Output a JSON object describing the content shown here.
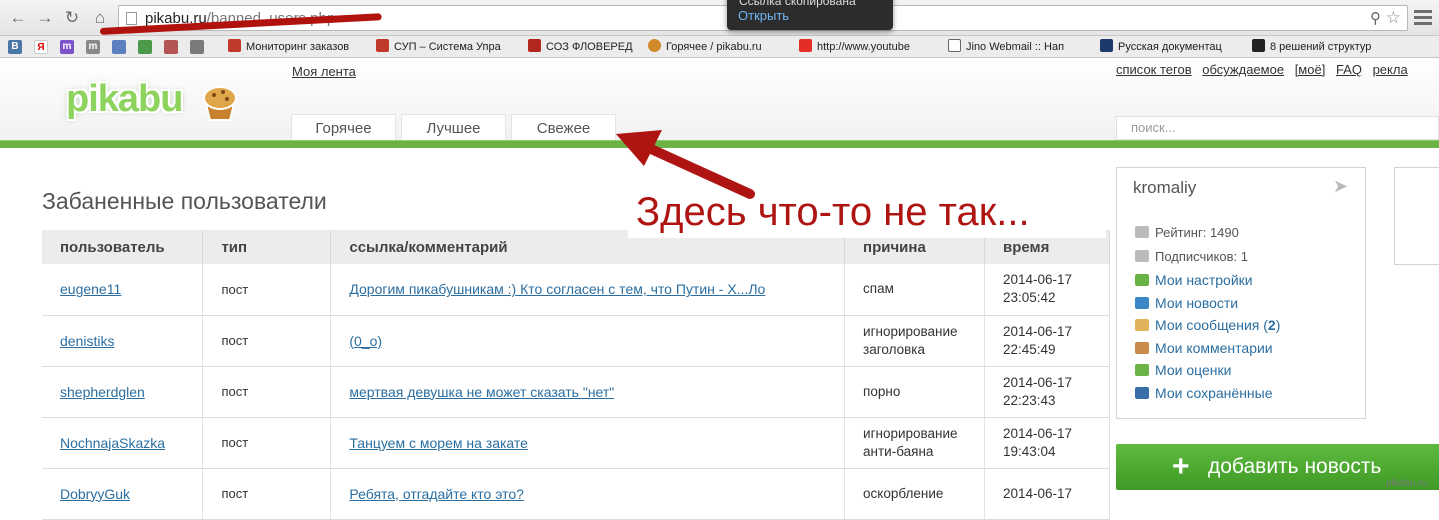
{
  "browser": {
    "url_host": "pikabu.ru",
    "url_path": "/banned_users.php",
    "popup": {
      "copied_text": "Ссылка скопирована",
      "open_label": "Открыть"
    },
    "bookmarks": [
      "Мониторинг заказов",
      "СУП – Система Упра",
      "СОЗ ФЛОВЕРЕД",
      "Горячее / pikabu.ru",
      "http://www.youtube",
      "Jino Webmail :: Нап",
      "Русская документац",
      "8 решений структур"
    ],
    "colors": {
      "annotation_red": "#ae1412",
      "site_green": "#6ab344",
      "link_blue": "#2a6ea1"
    }
  },
  "header": {
    "logo": "pikabu",
    "my_feed": "Моя лента",
    "top_links": [
      "список тегов",
      "обсуждаемое",
      "[моё]",
      "FAQ",
      "рекла"
    ],
    "tabs": [
      "Горячее",
      "Лучшее",
      "Свежее"
    ],
    "search_placeholder": "поиск..."
  },
  "main": {
    "title": "Забаненные пользователи",
    "annotation": "Здесь что-то не так...",
    "columns": [
      "пользователь",
      "тип",
      "ссылка/комментарий",
      "причина",
      "время"
    ],
    "rows": [
      {
        "user": "eugene11",
        "type": "пост",
        "link": "Дорогим пикабушникам :) Кто согласен с тем, что Путин - Х...Ло",
        "reason": "спам",
        "date": "2014-06-17",
        "time": "23:05:42"
      },
      {
        "user": "denistiks",
        "type": "пост",
        "link": "(0_о)",
        "reason": "игнорирование заголовка",
        "date": "2014-06-17",
        "time": "22:45:49"
      },
      {
        "user": "shepherdglen",
        "type": "пост",
        "link": "мертвая девушка не может сказать \"нет\"",
        "reason": "порно",
        "date": "2014-06-17",
        "time": "22:23:43"
      },
      {
        "user": "NochnajaSkazka",
        "type": "пост",
        "link": "Танцуем с морем на закате",
        "reason": "игнорирование анти-баяна",
        "date": "2014-06-17",
        "time": "19:43:04"
      },
      {
        "user": "DobryyGuk",
        "type": "пост",
        "link": "Ребята, отгадайте кто это?",
        "reason": "оскорбление",
        "date": "2014-06-17",
        "time": ""
      }
    ]
  },
  "sidebar": {
    "username": "kromaliy",
    "rating": "Рейтинг: 1490",
    "subscribers": "Подписчиков: 1",
    "menu": [
      {
        "label": "Мои настройки",
        "icon": "gear-icon",
        "color": "#6ab344"
      },
      {
        "label": "Мои новости",
        "icon": "news-icon",
        "color": "#3a87c8"
      },
      {
        "label": "Мои сообщения",
        "count": "2",
        "icon": "envelope-icon",
        "color": "#e0b35a"
      },
      {
        "label": "Мои комментарии",
        "icon": "comment-icon",
        "color": "#c98a4a"
      },
      {
        "label": "Мои оценки",
        "icon": "rating-icon",
        "color": "#6ab344"
      },
      {
        "label": "Мои сохранённые",
        "icon": "save-icon",
        "color": "#3a6ea8"
      }
    ],
    "add_news": "добавить новость"
  },
  "watermark": "pikabu.ru"
}
